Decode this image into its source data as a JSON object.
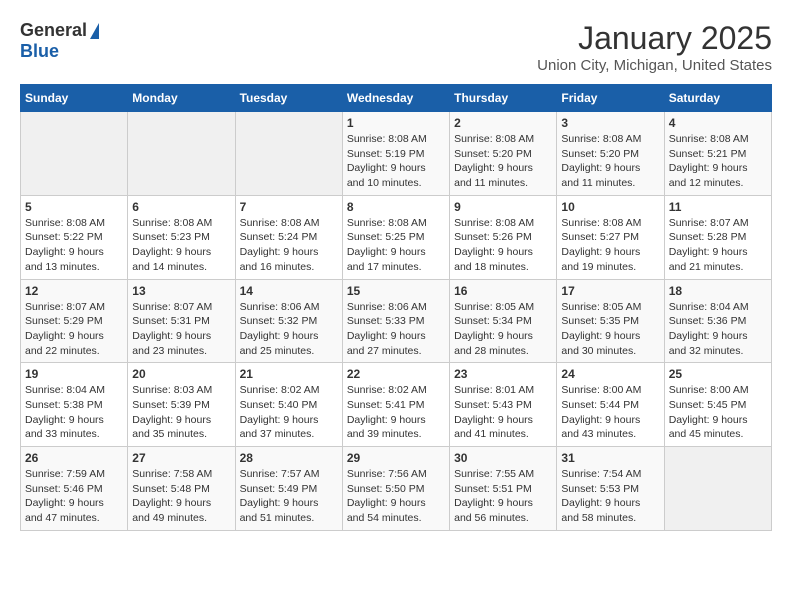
{
  "header": {
    "logo_general": "General",
    "logo_blue": "Blue",
    "title": "January 2025",
    "subtitle": "Union City, Michigan, United States"
  },
  "days_of_week": [
    "Sunday",
    "Monday",
    "Tuesday",
    "Wednesday",
    "Thursday",
    "Friday",
    "Saturday"
  ],
  "weeks": [
    [
      {
        "day": "",
        "empty": true
      },
      {
        "day": "",
        "empty": true
      },
      {
        "day": "",
        "empty": true
      },
      {
        "day": "1",
        "sunrise": "8:08 AM",
        "sunset": "5:19 PM",
        "daylight": "9 hours and 10 minutes."
      },
      {
        "day": "2",
        "sunrise": "8:08 AM",
        "sunset": "5:20 PM",
        "daylight": "9 hours and 11 minutes."
      },
      {
        "day": "3",
        "sunrise": "8:08 AM",
        "sunset": "5:20 PM",
        "daylight": "9 hours and 11 minutes."
      },
      {
        "day": "4",
        "sunrise": "8:08 AM",
        "sunset": "5:21 PM",
        "daylight": "9 hours and 12 minutes."
      }
    ],
    [
      {
        "day": "5",
        "sunrise": "8:08 AM",
        "sunset": "5:22 PM",
        "daylight": "9 hours and 13 minutes."
      },
      {
        "day": "6",
        "sunrise": "8:08 AM",
        "sunset": "5:23 PM",
        "daylight": "9 hours and 14 minutes."
      },
      {
        "day": "7",
        "sunrise": "8:08 AM",
        "sunset": "5:24 PM",
        "daylight": "9 hours and 16 minutes."
      },
      {
        "day": "8",
        "sunrise": "8:08 AM",
        "sunset": "5:25 PM",
        "daylight": "9 hours and 17 minutes."
      },
      {
        "day": "9",
        "sunrise": "8:08 AM",
        "sunset": "5:26 PM",
        "daylight": "9 hours and 18 minutes."
      },
      {
        "day": "10",
        "sunrise": "8:08 AM",
        "sunset": "5:27 PM",
        "daylight": "9 hours and 19 minutes."
      },
      {
        "day": "11",
        "sunrise": "8:07 AM",
        "sunset": "5:28 PM",
        "daylight": "9 hours and 21 minutes."
      }
    ],
    [
      {
        "day": "12",
        "sunrise": "8:07 AM",
        "sunset": "5:29 PM",
        "daylight": "9 hours and 22 minutes."
      },
      {
        "day": "13",
        "sunrise": "8:07 AM",
        "sunset": "5:31 PM",
        "daylight": "9 hours and 23 minutes."
      },
      {
        "day": "14",
        "sunrise": "8:06 AM",
        "sunset": "5:32 PM",
        "daylight": "9 hours and 25 minutes."
      },
      {
        "day": "15",
        "sunrise": "8:06 AM",
        "sunset": "5:33 PM",
        "daylight": "9 hours and 27 minutes."
      },
      {
        "day": "16",
        "sunrise": "8:05 AM",
        "sunset": "5:34 PM",
        "daylight": "9 hours and 28 minutes."
      },
      {
        "day": "17",
        "sunrise": "8:05 AM",
        "sunset": "5:35 PM",
        "daylight": "9 hours and 30 minutes."
      },
      {
        "day": "18",
        "sunrise": "8:04 AM",
        "sunset": "5:36 PM",
        "daylight": "9 hours and 32 minutes."
      }
    ],
    [
      {
        "day": "19",
        "sunrise": "8:04 AM",
        "sunset": "5:38 PM",
        "daylight": "9 hours and 33 minutes."
      },
      {
        "day": "20",
        "sunrise": "8:03 AM",
        "sunset": "5:39 PM",
        "daylight": "9 hours and 35 minutes."
      },
      {
        "day": "21",
        "sunrise": "8:02 AM",
        "sunset": "5:40 PM",
        "daylight": "9 hours and 37 minutes."
      },
      {
        "day": "22",
        "sunrise": "8:02 AM",
        "sunset": "5:41 PM",
        "daylight": "9 hours and 39 minutes."
      },
      {
        "day": "23",
        "sunrise": "8:01 AM",
        "sunset": "5:43 PM",
        "daylight": "9 hours and 41 minutes."
      },
      {
        "day": "24",
        "sunrise": "8:00 AM",
        "sunset": "5:44 PM",
        "daylight": "9 hours and 43 minutes."
      },
      {
        "day": "25",
        "sunrise": "8:00 AM",
        "sunset": "5:45 PM",
        "daylight": "9 hours and 45 minutes."
      }
    ],
    [
      {
        "day": "26",
        "sunrise": "7:59 AM",
        "sunset": "5:46 PM",
        "daylight": "9 hours and 47 minutes."
      },
      {
        "day": "27",
        "sunrise": "7:58 AM",
        "sunset": "5:48 PM",
        "daylight": "9 hours and 49 minutes."
      },
      {
        "day": "28",
        "sunrise": "7:57 AM",
        "sunset": "5:49 PM",
        "daylight": "9 hours and 51 minutes."
      },
      {
        "day": "29",
        "sunrise": "7:56 AM",
        "sunset": "5:50 PM",
        "daylight": "9 hours and 54 minutes."
      },
      {
        "day": "30",
        "sunrise": "7:55 AM",
        "sunset": "5:51 PM",
        "daylight": "9 hours and 56 minutes."
      },
      {
        "day": "31",
        "sunrise": "7:54 AM",
        "sunset": "5:53 PM",
        "daylight": "9 hours and 58 minutes."
      },
      {
        "day": "",
        "empty": true
      }
    ]
  ]
}
